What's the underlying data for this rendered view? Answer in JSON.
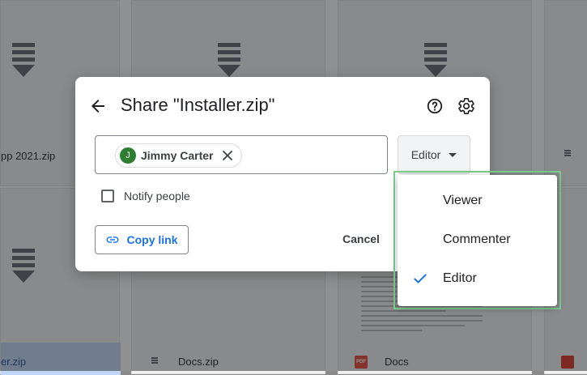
{
  "background": {
    "files": [
      {
        "name": "pp 2021.zip"
      },
      {
        "name": "er.zip"
      },
      {
        "name": "Docs.zip"
      },
      {
        "name": "Docs"
      }
    ]
  },
  "dialog": {
    "title": "Share \"Installer.zip\"",
    "back_icon": "arrow-back-icon",
    "help_icon": "help-circle-icon",
    "settings_icon": "gear-icon",
    "recipient": {
      "initial": "J",
      "name": "Jimmy Carter",
      "avatar_color": "#2e7d32"
    },
    "role_select": {
      "label": "Editor"
    },
    "notify_label": "Notify people",
    "copy_link_label": "Copy link",
    "cancel_label": "Cancel",
    "accent_color": "#1a73e8"
  },
  "role_menu": {
    "items": [
      {
        "label": "Viewer",
        "selected": false
      },
      {
        "label": "Commenter",
        "selected": false
      },
      {
        "label": "Editor",
        "selected": true
      }
    ]
  }
}
